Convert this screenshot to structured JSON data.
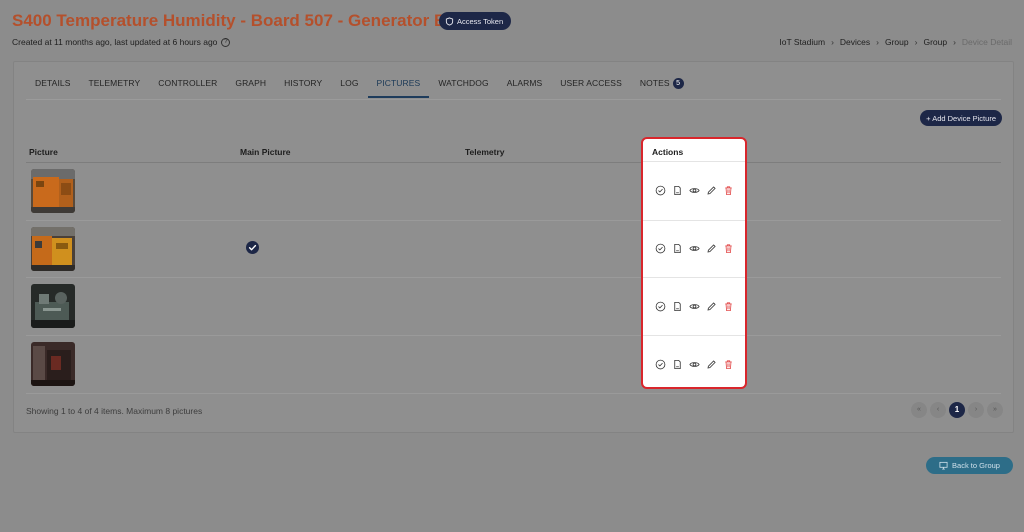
{
  "header": {
    "title": "S400 Temperature Humidity - Board 507 - Generator Battery",
    "access_token_label": "Access Token",
    "subtitle": "Created at 11 months ago, last updated at 6 hours ago",
    "breadcrumbs": [
      "IoT Stadium",
      "Devices",
      "Group",
      "Group",
      "Device Detail"
    ]
  },
  "tabs": [
    {
      "label": "DETAILS"
    },
    {
      "label": "TELEMETRY"
    },
    {
      "label": "CONTROLLER"
    },
    {
      "label": "GRAPH"
    },
    {
      "label": "HISTORY"
    },
    {
      "label": "LOG"
    },
    {
      "label": "PICTURES",
      "active": true
    },
    {
      "label": "WATCHDOG"
    },
    {
      "label": "ALARMS"
    },
    {
      "label": "USER ACCESS"
    },
    {
      "label": "NOTES",
      "badge": "5"
    }
  ],
  "add_button_label": "+ Add Device Picture",
  "table": {
    "columns": [
      "Picture",
      "Main Picture",
      "Telemetry",
      "Actions"
    ],
    "rows": [
      {
        "main": false
      },
      {
        "main": true
      },
      {
        "main": false
      },
      {
        "main": false
      }
    ],
    "row_actions": [
      "check-circle-icon",
      "document-icon",
      "eye-icon",
      "pencil-icon",
      "trash-icon"
    ]
  },
  "footer": {
    "summary": "Showing 1 to 4 of 4 items. Maximum 8 pictures",
    "pager": [
      "«",
      "‹",
      "1",
      "›",
      "»"
    ],
    "current_page": "1"
  },
  "back_button_label": "Back to Group",
  "colors": {
    "title": "#b4502c",
    "navy": "#1d2747",
    "highlight": "#d9262c",
    "delete": "#e24a4a"
  }
}
